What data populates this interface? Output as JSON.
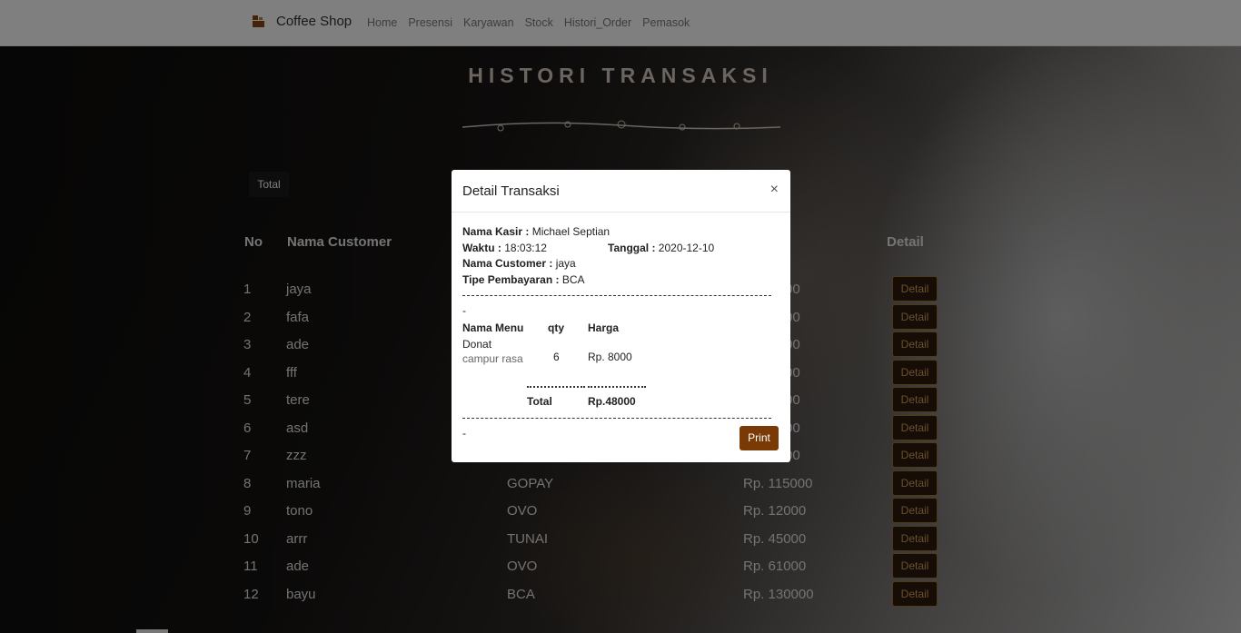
{
  "navbar": {
    "brand": "Coffee Shop",
    "links": [
      "Home",
      "Presensi",
      "Karyawan",
      "Stock",
      "Histori_Order",
      "Pemasok"
    ]
  },
  "page": {
    "title": "HISTORI TRANSAKSI",
    "total_button": "Total"
  },
  "table": {
    "headers": {
      "no": "No",
      "customer": "Nama Customer",
      "detail": "Detail"
    },
    "detail_label": "Detail",
    "rows": [
      {
        "no": "1",
        "customer": "jaya",
        "payment": "",
        "total": ""
      },
      {
        "no": "2",
        "customer": "fafa",
        "payment": "",
        "total": ""
      },
      {
        "no": "3",
        "customer": "ade",
        "payment": "",
        "total": ""
      },
      {
        "no": "4",
        "customer": "fff",
        "payment": "",
        "total": ""
      },
      {
        "no": "5",
        "customer": "tere",
        "payment": "",
        "total": ""
      },
      {
        "no": "6",
        "customer": "asd",
        "payment": "",
        "total": ""
      },
      {
        "no": "7",
        "customer": "zzz",
        "payment": "",
        "total": ""
      },
      {
        "no": "8",
        "customer": "maria",
        "payment": "GOPAY",
        "total": "Rp. 115000"
      },
      {
        "no": "9",
        "customer": "tono",
        "payment": "OVO",
        "total": "Rp. 12000"
      },
      {
        "no": "10",
        "customer": "arrr",
        "payment": "TUNAI",
        "total": "Rp. 45000"
      },
      {
        "no": "11",
        "customer": "ade",
        "payment": "OVO",
        "total": "Rp. 61000"
      },
      {
        "no": "12",
        "customer": "bayu",
        "payment": "BCA",
        "total": "Rp. 130000"
      }
    ],
    "partial_totals": [
      "00",
      "00",
      "00",
      "00",
      "00",
      "00",
      "00"
    ]
  },
  "modal": {
    "title": "Detail Transaksi",
    "close": "×",
    "kasir_label": "Nama Kasir :",
    "kasir": "Michael Septian",
    "waktu_label": "Waktu :",
    "waktu": "18:03:12",
    "tanggal_label": "Tanggal :",
    "tanggal": "2020-12-10",
    "customer_label": "Nama Customer :",
    "customer": "jaya",
    "payment_label": "Tipe Pembayaran :",
    "payment": "BCA",
    "dash1": "-",
    "col_menu": "Nama Menu",
    "col_qty": "qty",
    "col_harga": "Harga",
    "item_name": "Donat",
    "item_variant": "campur rasa",
    "item_qty": "6",
    "item_harga": "Rp. 8000",
    "total_label": "Total",
    "total_value": "Rp.48000",
    "dash2": "-",
    "print": "Print"
  }
}
